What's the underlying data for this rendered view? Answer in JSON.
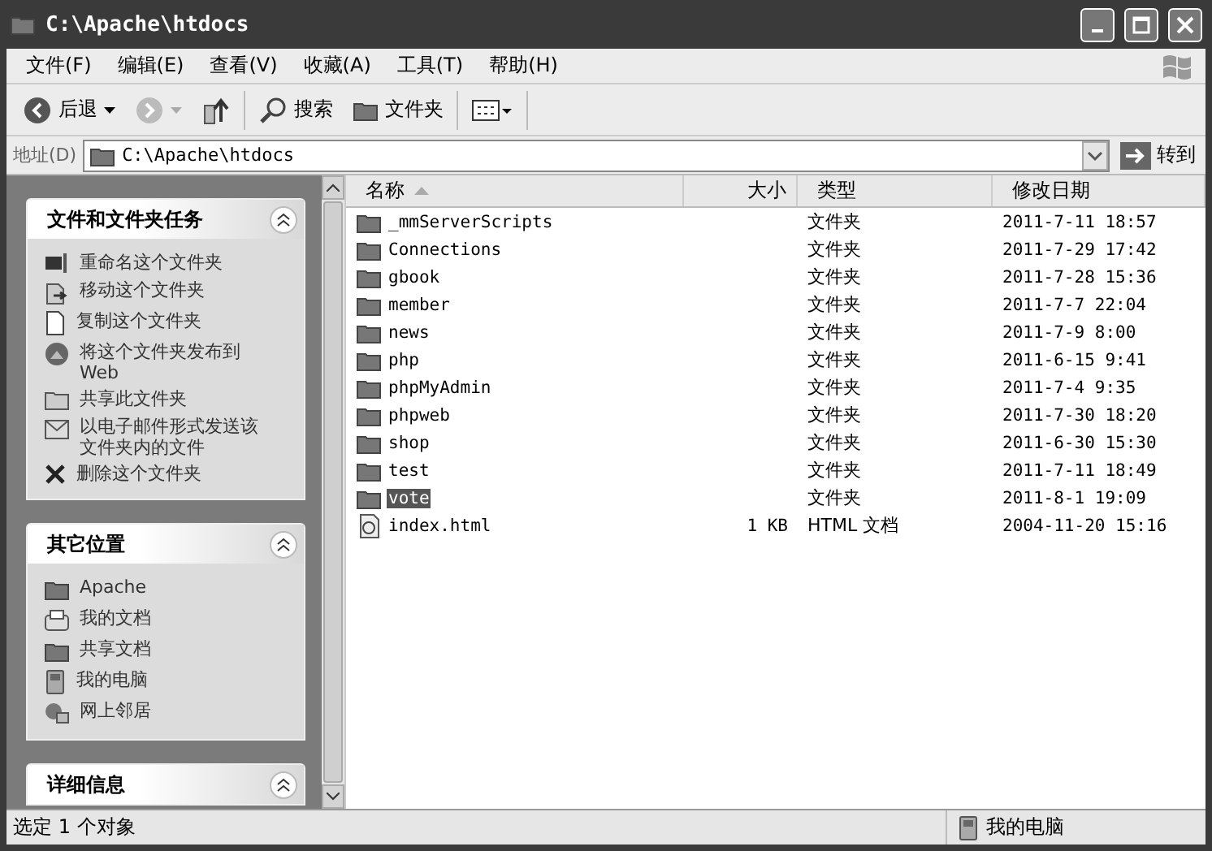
{
  "window": {
    "title": "C:\\Apache\\htdocs"
  },
  "menu": [
    "文件(F)",
    "编辑(E)",
    "查看(V)",
    "收藏(A)",
    "工具(T)",
    "帮助(H)"
  ],
  "toolbar": [
    {
      "kind": "back",
      "label": "后退"
    },
    {
      "kind": "forward"
    },
    {
      "kind": "up"
    },
    {
      "kind": "search",
      "label": "搜索"
    },
    {
      "kind": "folders",
      "label": "文件夹"
    },
    {
      "kind": "views"
    }
  ],
  "address": {
    "label": "地址(D)",
    "value": "C:\\Apache\\htdocs",
    "go": "转到"
  },
  "panels": [
    {
      "title": "文件和文件夹任务",
      "items": [
        {
          "label": "重命名这个文件夹"
        },
        {
          "label": "移动这个文件夹"
        },
        {
          "label": "复制这个文件夹"
        },
        {
          "label": "将这个文件夹发布到 Web"
        },
        {
          "label": "共享此文件夹"
        },
        {
          "label": "以电子邮件形式发送该文件夹内的文件"
        },
        {
          "label": "删除这个文件夹"
        }
      ]
    },
    {
      "title": "其它位置",
      "items": [
        {
          "label": "Apache"
        },
        {
          "label": "我的文档"
        },
        {
          "label": "共享文档"
        },
        {
          "label": "我的电脑"
        },
        {
          "label": "网上邻居"
        }
      ]
    },
    {
      "title": "详细信息"
    }
  ],
  "table": {
    "columns": [
      "名称",
      "大小",
      "类型",
      "修改日期"
    ],
    "rows": [
      {
        "kind": "folder",
        "name": "_mmServerScripts",
        "size": "",
        "type": "文件夹",
        "modified": "2011-7-11 18:57",
        "selected": false
      },
      {
        "kind": "folder",
        "name": "Connections",
        "size": "",
        "type": "文件夹",
        "modified": "2011-7-29 17:42",
        "selected": false
      },
      {
        "kind": "folder",
        "name": "gbook",
        "size": "",
        "type": "文件夹",
        "modified": "2011-7-28 15:36",
        "selected": false
      },
      {
        "kind": "folder",
        "name": "member",
        "size": "",
        "type": "文件夹",
        "modified": "2011-7-7 22:04",
        "selected": false
      },
      {
        "kind": "folder",
        "name": "news",
        "size": "",
        "type": "文件夹",
        "modified": "2011-7-9 8:00",
        "selected": false
      },
      {
        "kind": "folder",
        "name": "php",
        "size": "",
        "type": "文件夹",
        "modified": "2011-6-15 9:41",
        "selected": false
      },
      {
        "kind": "folder",
        "name": "phpMyAdmin",
        "size": "",
        "type": "文件夹",
        "modified": "2011-7-4 9:35",
        "selected": false
      },
      {
        "kind": "folder",
        "name": "phpweb",
        "size": "",
        "type": "文件夹",
        "modified": "2011-7-30 18:20",
        "selected": false
      },
      {
        "kind": "folder",
        "name": "shop",
        "size": "",
        "type": "文件夹",
        "modified": "2011-6-30 15:30",
        "selected": false
      },
      {
        "kind": "folder",
        "name": "test",
        "size": "",
        "type": "文件夹",
        "modified": "2011-7-11 18:49",
        "selected": false
      },
      {
        "kind": "folder",
        "name": "vote",
        "size": "",
        "type": "文件夹",
        "modified": "2011-8-1 19:09",
        "selected": true
      },
      {
        "kind": "html",
        "name": "index.html",
        "size": "1 KB",
        "type": "HTML 文档",
        "modified": "2004-11-20 15:16",
        "selected": false
      }
    ]
  },
  "status_bar": {
    "text": "选定 1 个对象",
    "zone": "我的电脑"
  }
}
